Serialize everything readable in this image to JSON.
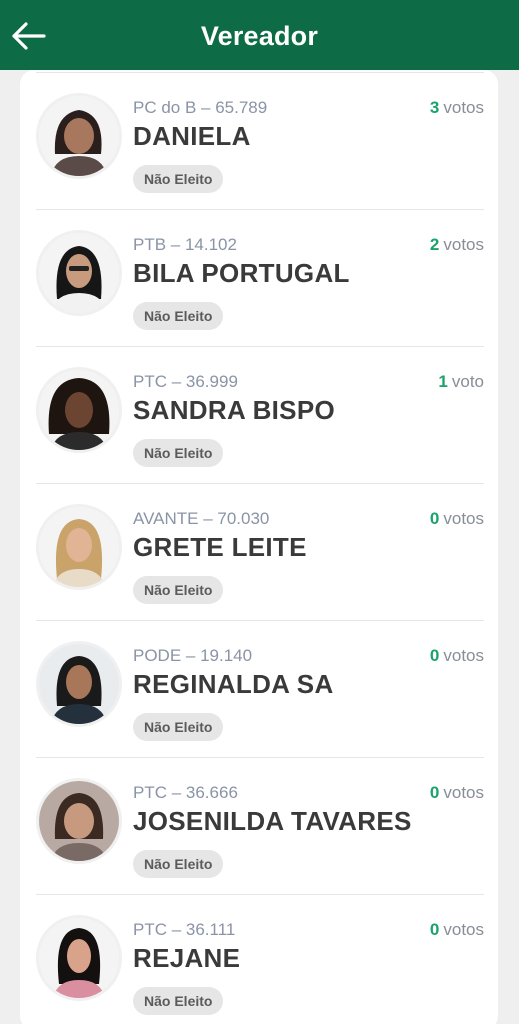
{
  "header": {
    "title": "Vereador",
    "back_icon": "arrow-left-icon"
  },
  "colors": {
    "brand": "#0d6b45",
    "accent": "#1aa36a"
  },
  "candidates": [
    {
      "party": "PC do B – 65.789",
      "name": "DANIELA",
      "votes": "3",
      "votes_label": "votos",
      "status": "Não Eleito"
    },
    {
      "party": "PTB – 14.102",
      "name": "BILA PORTUGAL",
      "votes": "2",
      "votes_label": "votos",
      "status": "Não Eleito"
    },
    {
      "party": "PTC – 36.999",
      "name": "SANDRA BISPO",
      "votes": "1",
      "votes_label": "voto",
      "status": "Não Eleito"
    },
    {
      "party": "AVANTE – 70.030",
      "name": "GRETE LEITE",
      "votes": "0",
      "votes_label": "votos",
      "status": "Não Eleito"
    },
    {
      "party": "PODE – 19.140",
      "name": "REGINALDA SA",
      "votes": "0",
      "votes_label": "votos",
      "status": "Não Eleito"
    },
    {
      "party": "PTC – 36.666",
      "name": "JOSENILDA TAVARES",
      "votes": "0",
      "votes_label": "votos",
      "status": "Não Eleito"
    },
    {
      "party": "PTC – 36.111",
      "name": "REJANE",
      "votes": "0",
      "votes_label": "votos",
      "status": "Não Eleito"
    }
  ]
}
